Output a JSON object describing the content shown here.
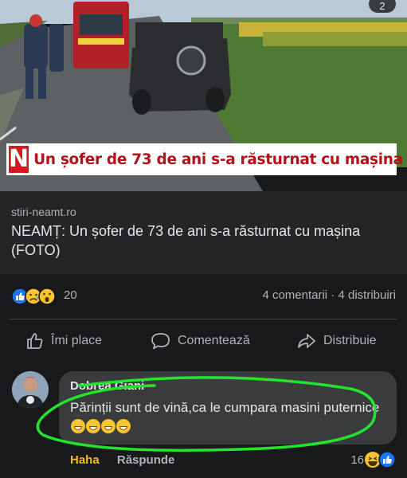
{
  "photo": {
    "badge_count": "2",
    "headline_logo": "N",
    "headline": "Un șofer de 73 de ani s-a răsturnat cu mașina"
  },
  "link": {
    "domain": "stiri-neamt.ro",
    "title": "NEAMȚ: Un șofer de 73 de ani s-a răsturnat cu mașina (FOTO)"
  },
  "reactions": {
    "icons": [
      "like-icon",
      "sad-icon",
      "wow-icon"
    ],
    "count": "20",
    "stats": "4 comentarii · 4 distribuiri"
  },
  "actions": {
    "like": "Îmi place",
    "comment": "Comentează",
    "share": "Distribuie"
  },
  "comment": {
    "author": "Dobrea Giani",
    "text": "Părinții sunt de vină,ca le cumpara masini puternice",
    "emoji_count": 4,
    "haha": "Haha",
    "reply": "Răspunde",
    "reaction_count": "16",
    "reaction_icons": [
      "haha-icon",
      "like-icon"
    ]
  },
  "colors": {
    "background": "#18191a",
    "card": "#242526",
    "bubble": "#3a3b3c",
    "headline_red": "#b3121a",
    "annotation_green": "#22e42c",
    "haha_yellow": "#f7b928",
    "like_blue": "#1877f2"
  }
}
